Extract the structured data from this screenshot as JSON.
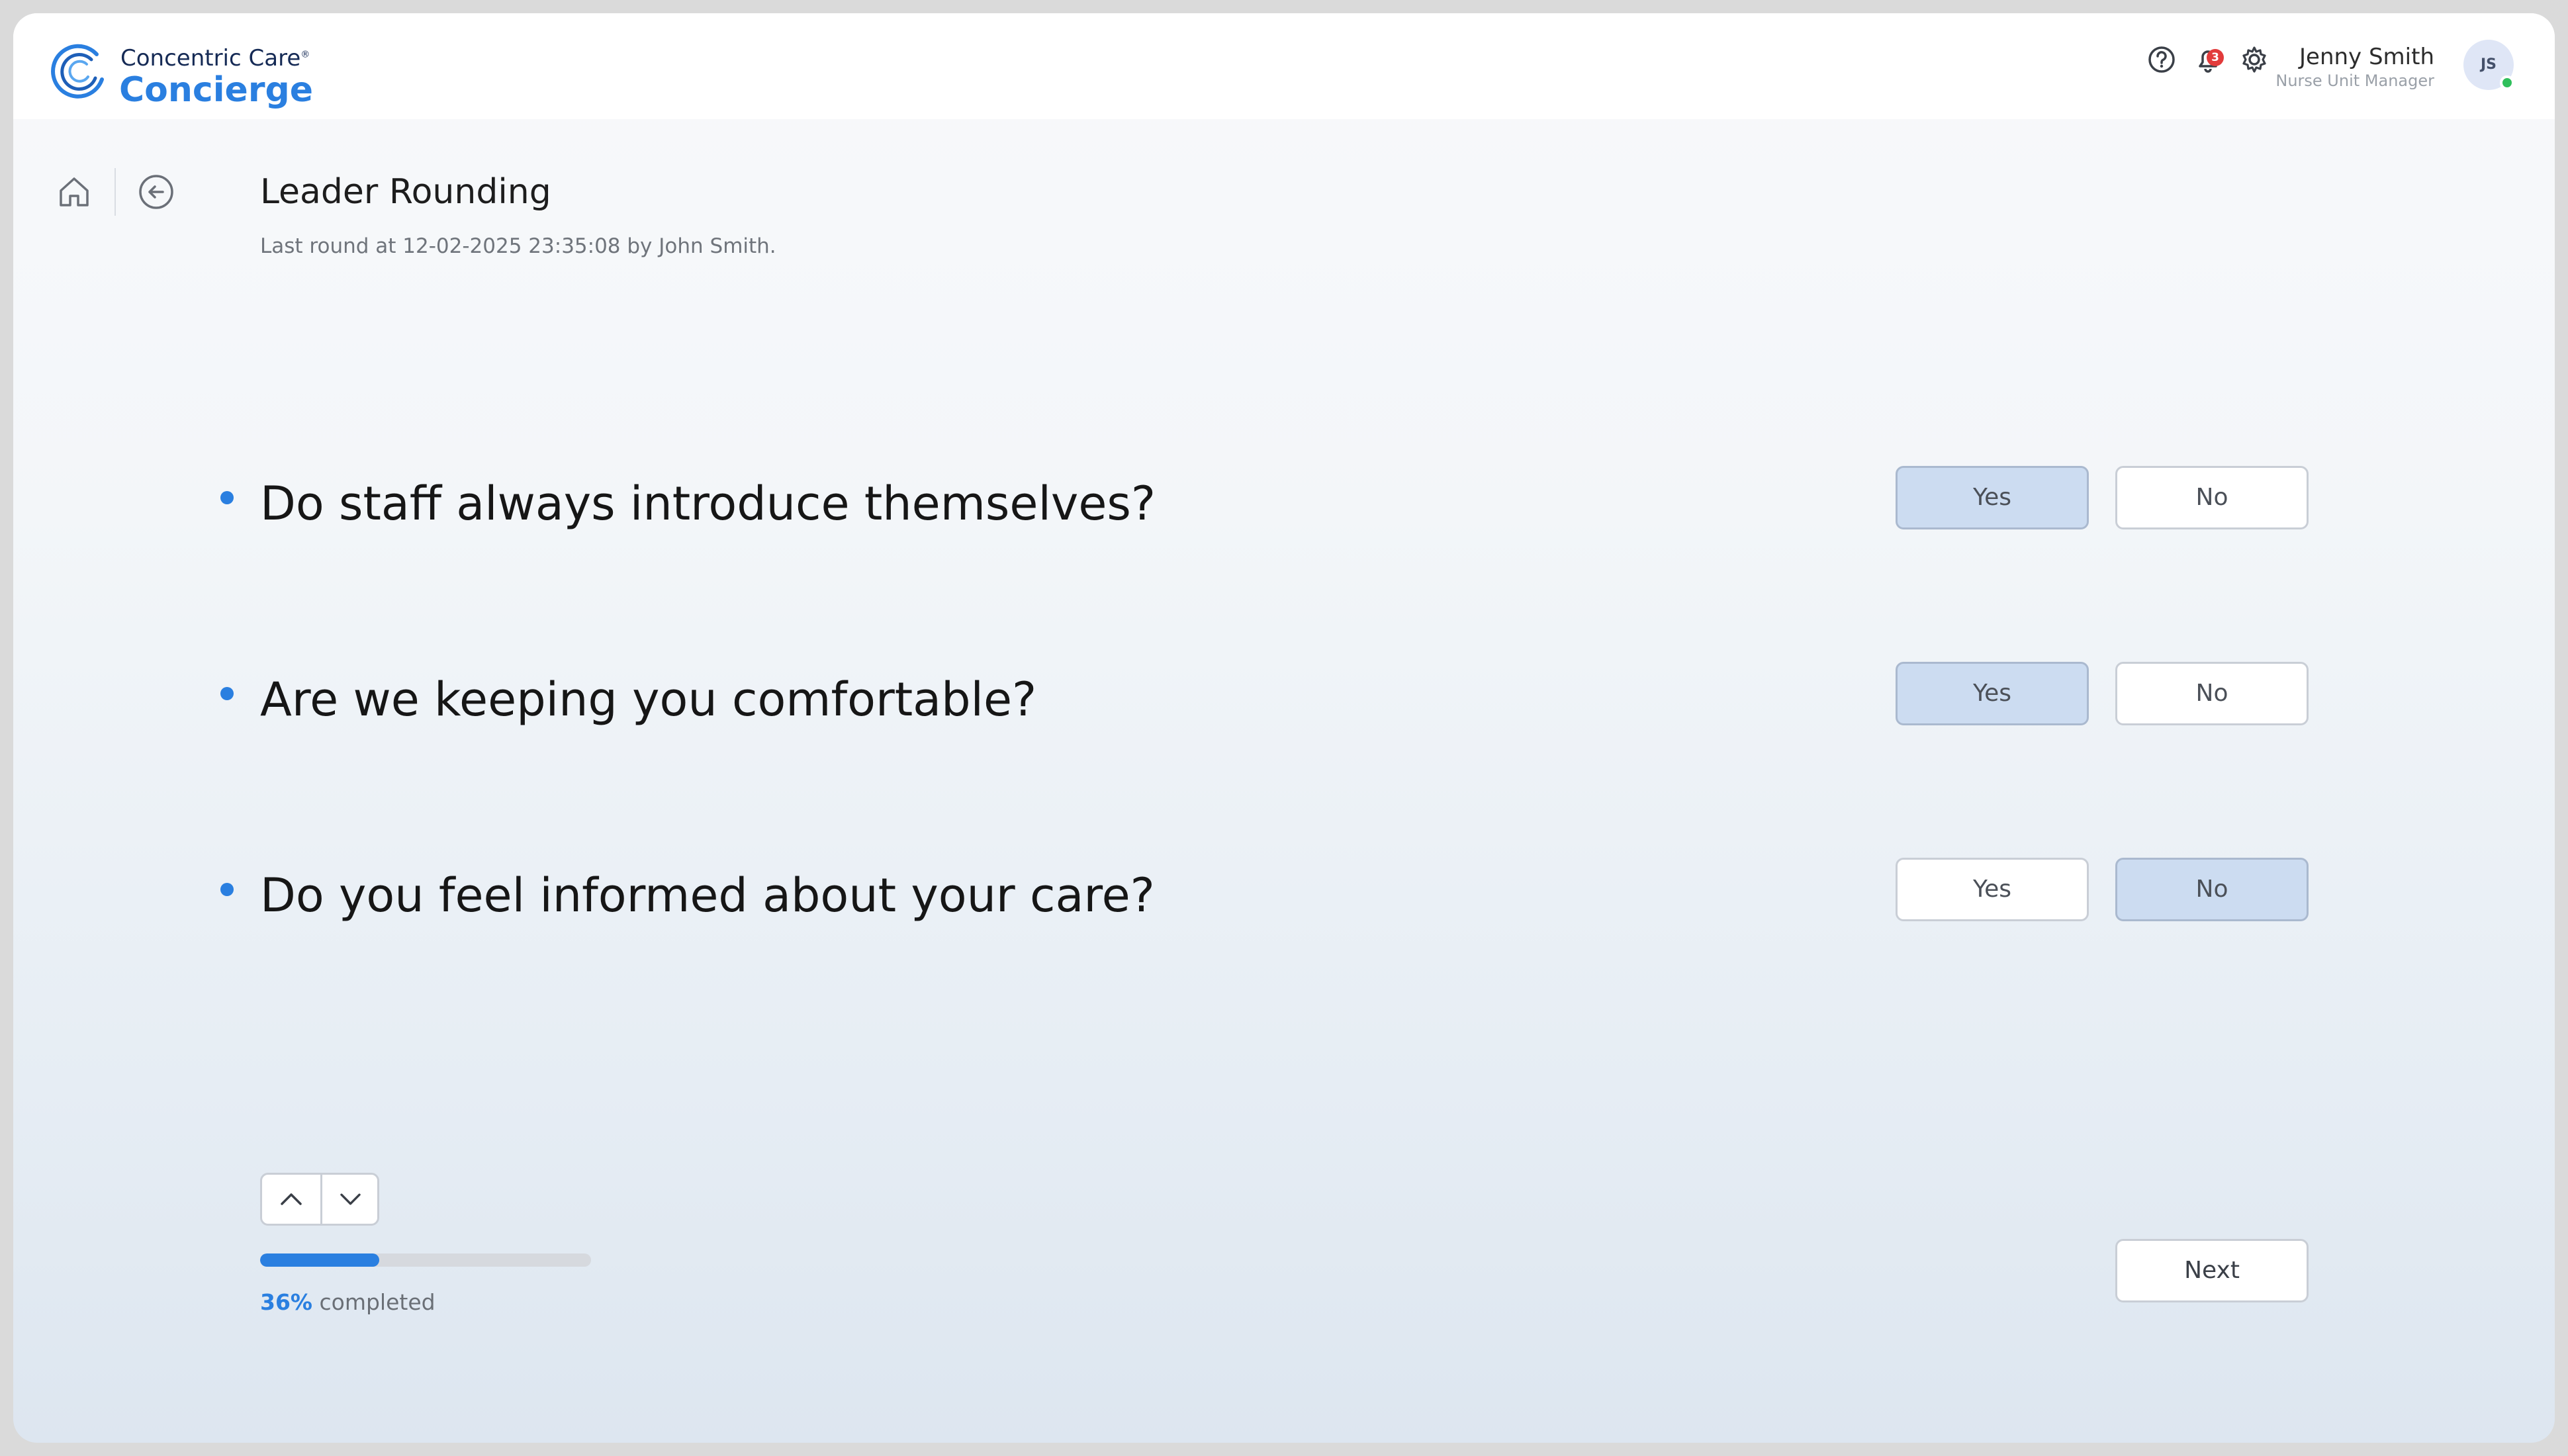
{
  "brand": {
    "top": "Concentric Care",
    "registered": "®",
    "main": "Concierge"
  },
  "header": {
    "icons": [
      "help-icon",
      "bell-icon",
      "gear-icon"
    ],
    "notification_count": "3",
    "user_name": "Jenny Smith",
    "user_role": "Nurse Unit Manager",
    "avatar_initials": "JS",
    "status": "online"
  },
  "page": {
    "title": "Leader Rounding",
    "last_round": "Last round at 12-02-2025 23:35:08 by John Smith."
  },
  "questions": [
    {
      "text": "Do staff always introduce themselves?",
      "yes_label": "Yes",
      "no_label": "No",
      "selected": "Yes"
    },
    {
      "text": "Are we keeping you comfortable?",
      "yes_label": "Yes",
      "no_label": "No",
      "selected": "Yes"
    },
    {
      "text": "Do you feel informed about your care?",
      "yes_label": "Yes",
      "no_label": "No",
      "selected": "No"
    }
  ],
  "progress": {
    "percent_label": "36%",
    "suffix": " completed",
    "value": 0.36
  },
  "actions": {
    "next_label": "Next"
  },
  "colors": {
    "accent": "#2a7fe0",
    "selected_bg": "#ccdcf1",
    "brand_navy": "#152a55",
    "online": "#2fbf5b",
    "badge": "#e23b3b"
  }
}
